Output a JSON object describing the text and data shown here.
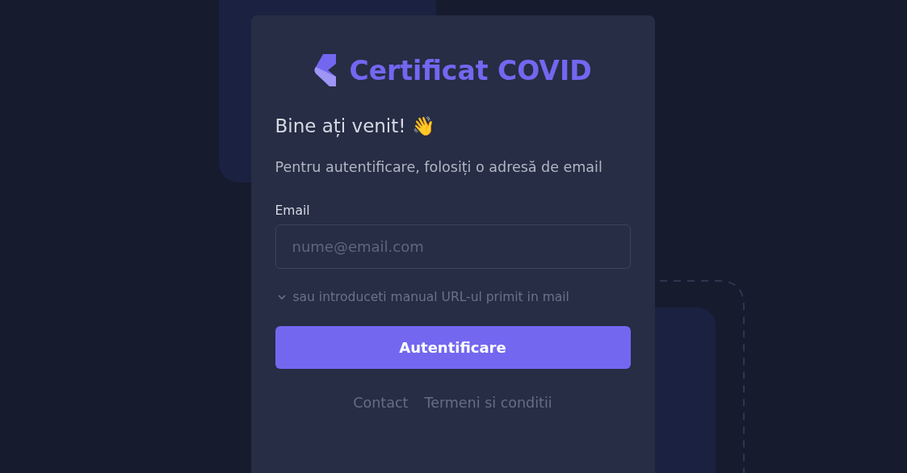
{
  "brand": {
    "title": "Certificat COVID"
  },
  "login": {
    "heading": "Bine ați venit! 👋",
    "description": "Pentru autentificare, folosiți o adresă de email",
    "email": {
      "label": "Email",
      "placeholder": "nume@email.com"
    },
    "manual_toggle": {
      "label": "sau introduceti manual URL-ul primit in mail",
      "expanded": false
    },
    "submit": "Autentificare"
  },
  "footer_links": [
    "Contact",
    "Termeni si conditii"
  ]
}
